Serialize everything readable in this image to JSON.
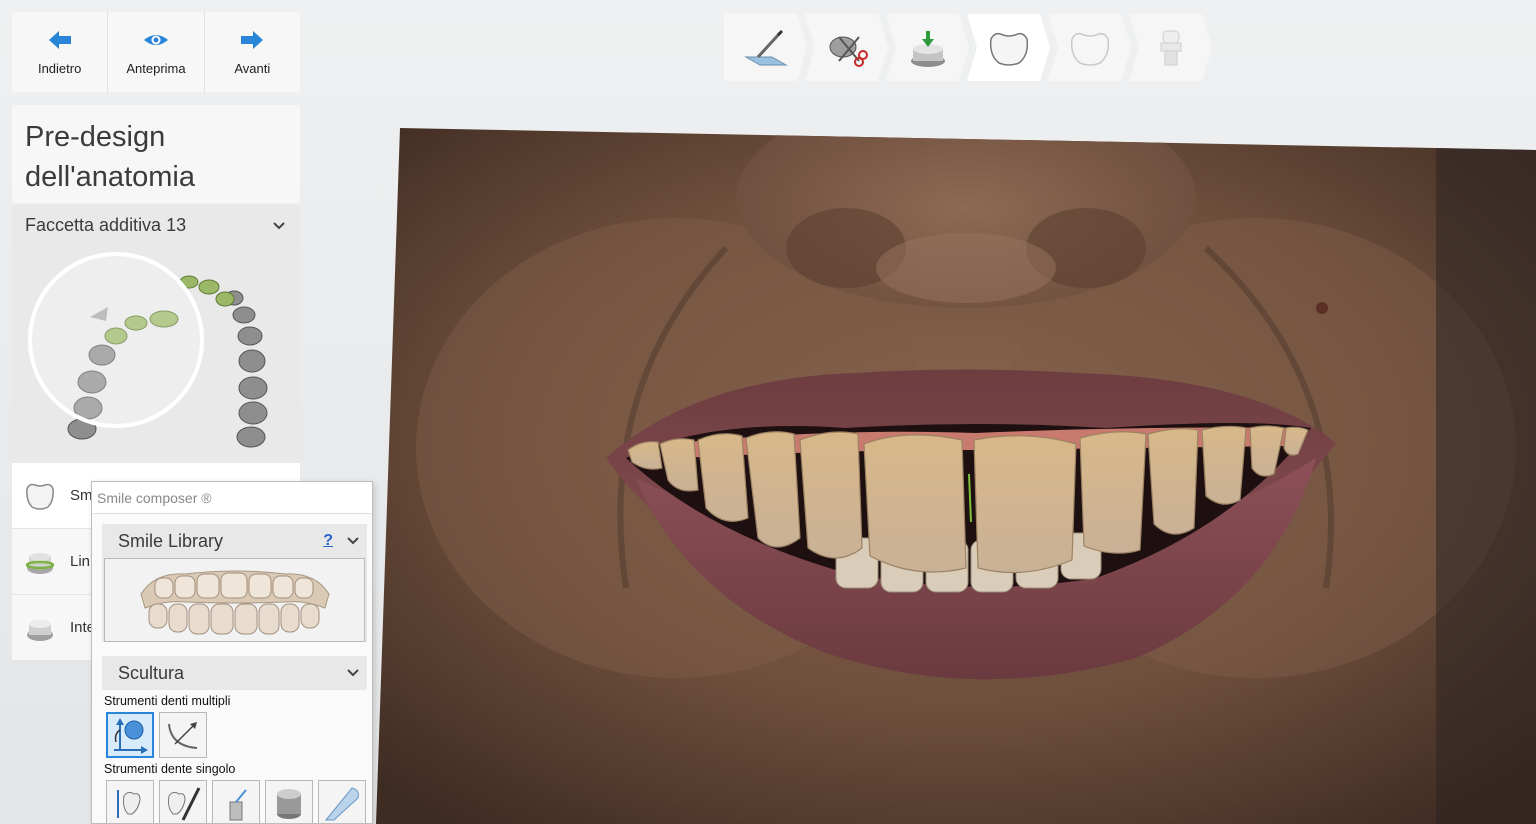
{
  "nav": {
    "back_label": "Indietro",
    "preview_label": "Anteprima",
    "next_label": "Avanti"
  },
  "panel": {
    "title_line1": "Pre-design",
    "title_line2": "dell'anatomia",
    "tooth_selector": "Faccetta additiva 13"
  },
  "steps": [
    {
      "label": "Sm",
      "icon": "crown-icon"
    },
    {
      "label": "Lin",
      "icon": "margin-line-icon"
    },
    {
      "label": "Inte",
      "icon": "insertion-icon"
    }
  ],
  "composer": {
    "title": "Smile composer ®",
    "library_label": "Smile Library",
    "help_label": "?",
    "sculpt_label": "Scultura",
    "multi_tools_label": "Strumenti denti multipli",
    "single_tools_label": "Strumenti dente singolo"
  },
  "workflow": {
    "steps": [
      "scan-knife-icon",
      "trim-scissors-icon",
      "margin-insert-icon",
      "crown-design-icon",
      "crown-finish-icon",
      "abutment-icon"
    ],
    "current_index": 3
  },
  "colors": {
    "accent": "#2a86d9",
    "arch_selected": "#9bb867",
    "arch_unselected": "#8e8e8e"
  }
}
